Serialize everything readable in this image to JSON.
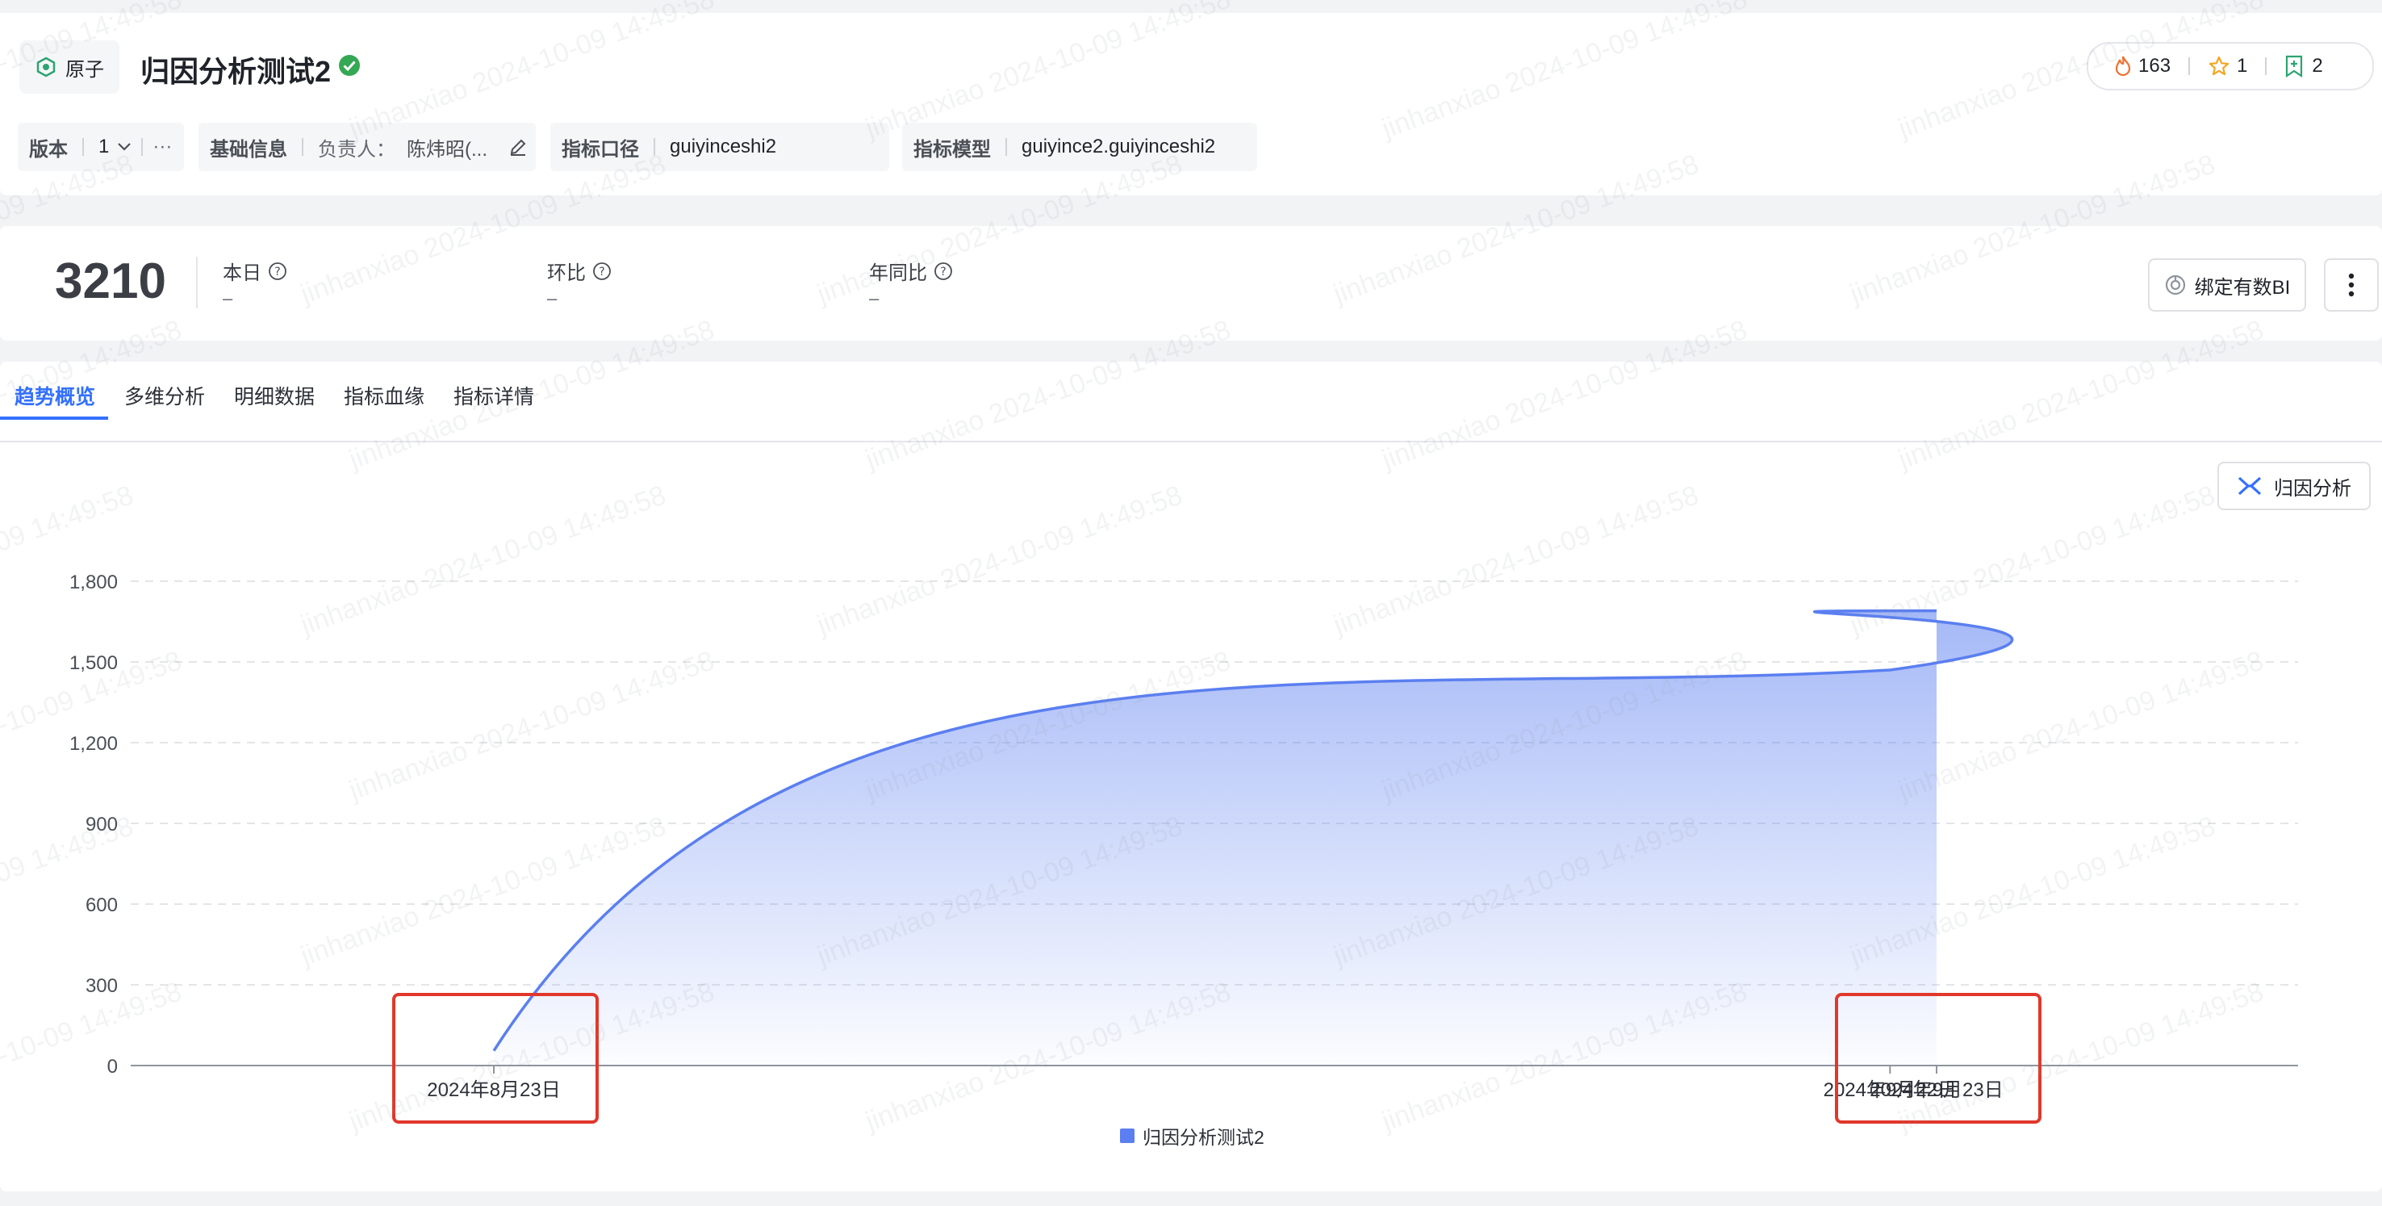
{
  "header": {
    "type_badge": "原子",
    "title": "归因分析测试2",
    "stats": {
      "hot": "163",
      "stars": "1",
      "bookmarks": "2"
    },
    "version_label": "版本",
    "version_value": "1",
    "more_label": "···",
    "basic_info_label": "基础信息",
    "owner_label": "负责人：",
    "owner_value": "陈炜昭(...",
    "metric_scope_label": "指标口径",
    "metric_scope_value": "guiyinceshi2",
    "metric_model_label": "指标模型",
    "metric_model_value": "guiyince2.guiyinceshi2"
  },
  "summary": {
    "value": "3210",
    "today_label": "本日",
    "today_value": "–",
    "mom_label": "环比",
    "mom_value": "–",
    "yoy_label": "年同比",
    "yoy_value": "–",
    "bind_button": "绑定有数BI"
  },
  "tabs": [
    "趋势概览",
    "多维分析",
    "明细数据",
    "指标血缘",
    "指标详情"
  ],
  "attribution_button": "归因分析",
  "watermark": "jinhanxiao 2024-10-09 14:49:58",
  "colors": {
    "accent": "#3370ff",
    "series": "#5b7ff0",
    "highlight_box": "#e0382b"
  },
  "chart_data": {
    "type": "area",
    "x": [
      "2024年8月23日",
      "2024年9月22日",
      "2024年9月23日"
    ],
    "tick_labels": [
      "2024年8月23日",
      "2024年9月22日",
      "2024年9月23日"
    ],
    "series": [
      {
        "name": "归因分析测试2",
        "values": [
          55,
          1470,
          1690
        ]
      }
    ],
    "ylim": [
      0,
      1800
    ],
    "yticks": [
      "0",
      "300",
      "600",
      "900",
      "1,200",
      "1,500",
      "1,800"
    ],
    "grid": true,
    "legend": "bottom-center",
    "highlighted_ticks": [
      "2024年8月23日",
      "2024年9月23日"
    ]
  }
}
